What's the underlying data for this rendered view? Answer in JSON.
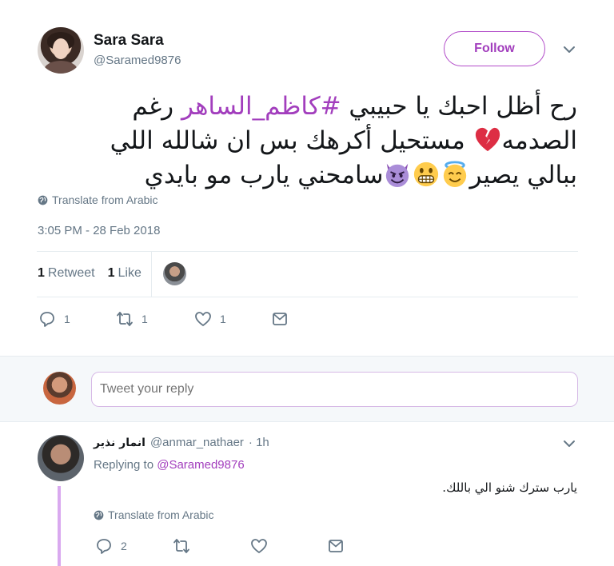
{
  "tweet": {
    "author": {
      "display_name": "Sara Sara",
      "screen_name": "@Saramed9876"
    },
    "follow_label": "Follow",
    "text_before_hashtag": "رح أظل احبك يا حبيبي ",
    "hashtag": "#كاظم_الساهر",
    "text_line1_end": " رغم",
    "text_line2_start": "الصدمه",
    "text_line2_end": " مستحيل أكرهك بس ان شالله اللي",
    "text_line3": "ببالي يصير",
    "text_line3_end": "سامحني يارب مو بايدي",
    "translate_label": "Translate from Arabic",
    "timestamp": "3:05 PM - 28 Feb 2018",
    "stats": {
      "retweet_count": "1",
      "retweet_label": "Retweet",
      "like_count": "1",
      "like_label": "Like"
    },
    "actions": {
      "reply_count": "1",
      "retweet_count": "1",
      "like_count": "1"
    },
    "emojis": [
      "broken-heart",
      "smiling-face-with-halo",
      "grimacing-face",
      "smiling-face-with-horns"
    ]
  },
  "composer": {
    "placeholder": "Tweet your reply"
  },
  "reply": {
    "display_name": "انمار نذير",
    "screen_name": "@anmar_nathaer",
    "time": "· 1h",
    "replying_to_label": "Replying to",
    "replying_to_handle": "@Saramed9876",
    "text": "يارب سترك شنو الي باللك.",
    "translate_label": "Translate from Arabic",
    "actions": {
      "reply_count": "2"
    }
  },
  "colors": {
    "accent": "#a23ebd",
    "muted": "#657786",
    "text": "#14171a",
    "divider": "#e6ecf0",
    "thread_line": "#d9a9ef"
  }
}
